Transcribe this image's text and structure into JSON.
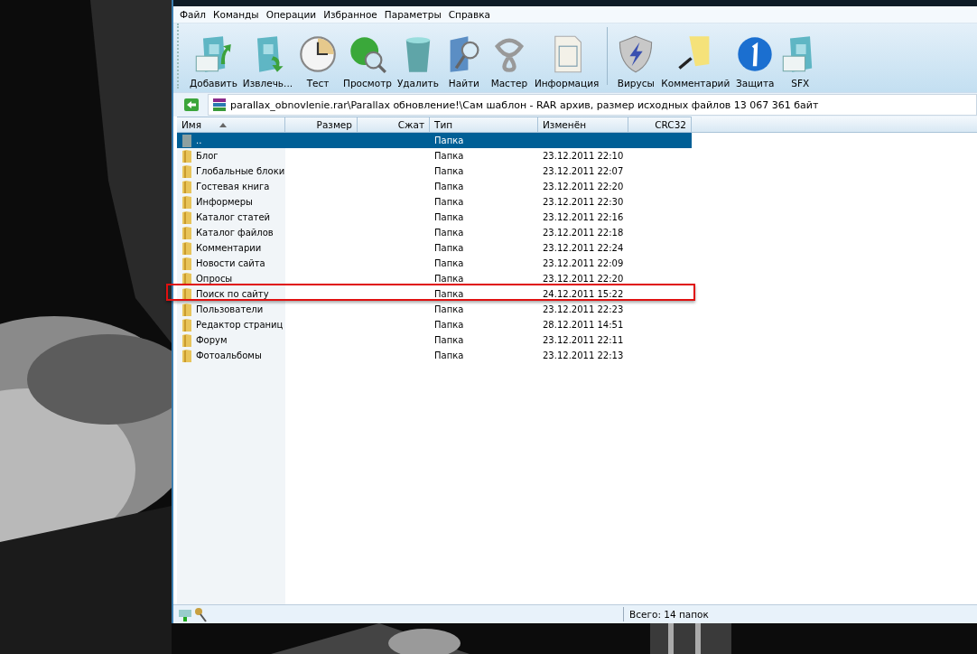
{
  "menu": [
    "Файл",
    "Команды",
    "Операции",
    "Избранное",
    "Параметры",
    "Справка"
  ],
  "toolbar": [
    {
      "label": "Добавить",
      "kind": "add"
    },
    {
      "label": "Извлечь...",
      "kind": "extract"
    },
    {
      "label": "Тест",
      "kind": "test"
    },
    {
      "label": "Просмотр",
      "kind": "view"
    },
    {
      "label": "Удалить",
      "kind": "delete"
    },
    {
      "label": "Найти",
      "kind": "find"
    },
    {
      "label": "Мастер",
      "kind": "wizard"
    },
    {
      "label": "Информация",
      "kind": "info"
    },
    {
      "label": "Вирусы",
      "kind": "virus",
      "group_start": true
    },
    {
      "label": "Комментарий",
      "kind": "comment"
    },
    {
      "label": "Защита",
      "kind": "protect"
    },
    {
      "label": "SFX",
      "kind": "sfx"
    }
  ],
  "path": "parallax_obnovlenie.rar\\Parallax обновление!\\Сам шаблон - RAR архив, размер исходных файлов 13 067 361 байт",
  "columns": [
    {
      "label": "Имя",
      "sorted": true
    },
    {
      "label": "Размер",
      "sorted": false
    },
    {
      "label": "Сжат",
      "sorted": false
    },
    {
      "label": "Тип",
      "sorted": false
    },
    {
      "label": "Изменён",
      "sorted": false
    },
    {
      "label": "CRC32",
      "sorted": false
    }
  ],
  "rows": [
    {
      "name": "..",
      "kind": "parent",
      "type": "Папка",
      "selected": true,
      "highlighted": false
    },
    {
      "name": "Блог",
      "kind": "folder",
      "type": "Папка",
      "modified": "23.12.2011 22:10",
      "selected": false,
      "highlighted": false
    },
    {
      "name": "Глобальные блоки",
      "kind": "folder",
      "type": "Папка",
      "modified": "23.12.2011 22:07",
      "selected": false,
      "highlighted": false
    },
    {
      "name": "Гостевая книга",
      "kind": "folder",
      "type": "Папка",
      "modified": "23.12.2011 22:20",
      "selected": false,
      "highlighted": false
    },
    {
      "name": "Информеры",
      "kind": "folder",
      "type": "Папка",
      "modified": "23.12.2011 22:30",
      "selected": false,
      "highlighted": false
    },
    {
      "name": "Каталог статей",
      "kind": "folder",
      "type": "Папка",
      "modified": "23.12.2011 22:16",
      "selected": false,
      "highlighted": false
    },
    {
      "name": "Каталог файлов",
      "kind": "folder",
      "type": "Папка",
      "modified": "23.12.2011 22:18",
      "selected": false,
      "highlighted": false
    },
    {
      "name": "Комментарии",
      "kind": "folder",
      "type": "Папка",
      "modified": "23.12.2011 22:24",
      "selected": false,
      "highlighted": false
    },
    {
      "name": "Новости сайта",
      "kind": "folder",
      "type": "Папка",
      "modified": "23.12.2011 22:09",
      "selected": false,
      "highlighted": false
    },
    {
      "name": "Опросы",
      "kind": "folder",
      "type": "Папка",
      "modified": "23.12.2011 22:20",
      "selected": false,
      "highlighted": false
    },
    {
      "name": "Поиск по сайту",
      "kind": "folder",
      "type": "Папка",
      "modified": "24.12.2011 15:22",
      "selected": false,
      "highlighted": true
    },
    {
      "name": "Пользователи",
      "kind": "folder",
      "type": "Папка",
      "modified": "23.12.2011 22:23",
      "selected": false,
      "highlighted": false
    },
    {
      "name": "Редактор страниц",
      "kind": "folder",
      "type": "Папка",
      "modified": "28.12.2011 14:51",
      "selected": false,
      "highlighted": false
    },
    {
      "name": "Форум",
      "kind": "folder",
      "type": "Папка",
      "modified": "23.12.2011 22:11",
      "selected": false,
      "highlighted": false
    },
    {
      "name": "Фотоальбомы",
      "kind": "folder",
      "type": "Папка",
      "modified": "23.12.2011 22:13",
      "selected": false,
      "highlighted": false
    }
  ],
  "status_bar": {
    "total": "Всего: 14 папок"
  }
}
